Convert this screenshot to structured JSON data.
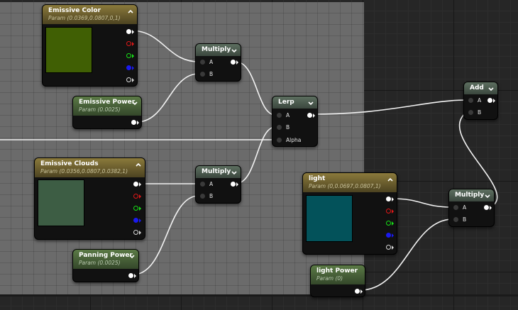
{
  "graph": {
    "comment_color": "#6b6b6b",
    "nodes": {
      "emissive_color": {
        "title": "Emissive Color",
        "subtitle": "Param (0.0369,0.0807,0,1)",
        "swatch_color": "#405f04"
      },
      "emissive_power": {
        "title": "Emissive Power",
        "subtitle": "Param (0.0025)"
      },
      "multiply_top": {
        "title": "Multiply",
        "pin_a": "A",
        "pin_b": "B"
      },
      "lerp": {
        "title": "Lerp",
        "pin_a": "A",
        "pin_b": "B",
        "pin_alpha": "Alpha"
      },
      "emissive_clouds": {
        "title": "Emissive Clouds",
        "subtitle": "Param (0.0356,0.0807,0.0382,1)",
        "swatch_color": "#3d5d44"
      },
      "multiply_mid": {
        "title": "Multiply",
        "pin_a": "A",
        "pin_b": "B"
      },
      "panning_power": {
        "title": "Panning Power",
        "subtitle": "Param (0.0025)"
      },
      "light": {
        "title": "light",
        "subtitle": "Param (0,0.0697,0.0807,1)",
        "swatch_color": "#03525a"
      },
      "light_power": {
        "title": "light Power",
        "subtitle": "Param (0)"
      },
      "multiply_right": {
        "title": "Multiply",
        "pin_a": "A",
        "pin_b": "B"
      },
      "add": {
        "title": "Add",
        "pin_a": "A",
        "pin_b": "B"
      }
    }
  }
}
